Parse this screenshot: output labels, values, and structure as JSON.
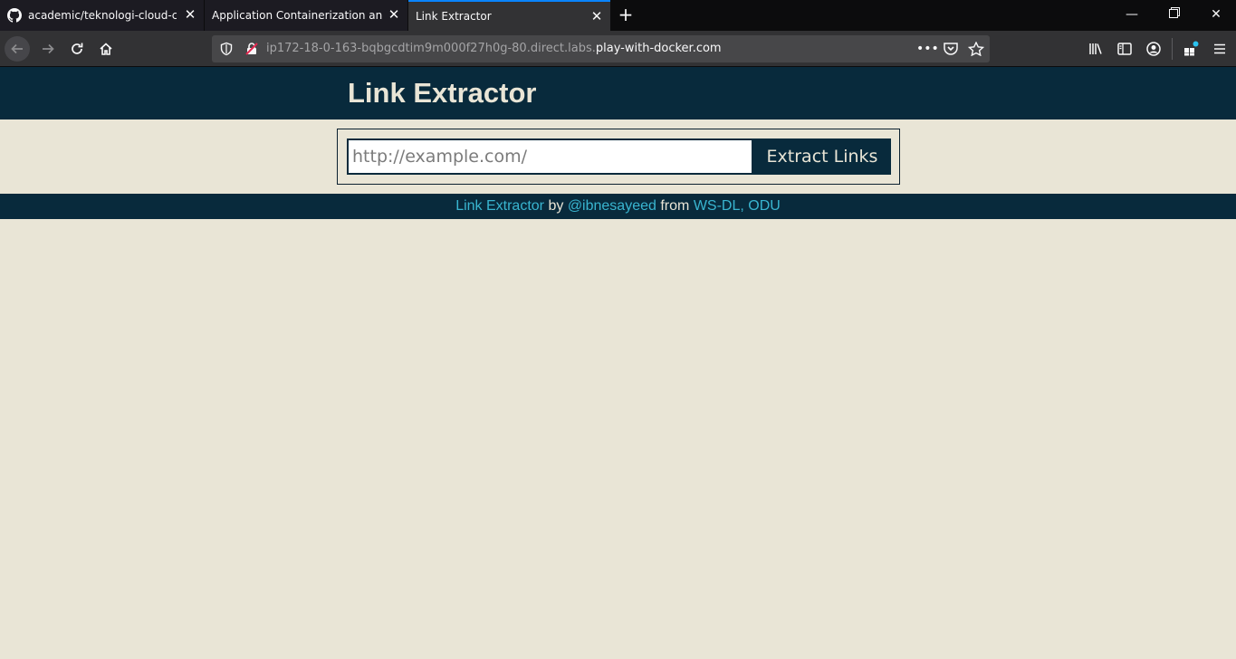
{
  "browser": {
    "tabs": [
      {
        "title": "academic/teknologi-cloud-com",
        "icon": "github-icon",
        "active": false
      },
      {
        "title": "Application Containerization and M",
        "active": false
      },
      {
        "title": "Link Extractor",
        "active": true
      }
    ],
    "url": {
      "prefix": "ip172-18-0-163-bqbgcdtim9m000f27h0g-80.direct.labs.",
      "domain": "play-with-docker.com"
    }
  },
  "page": {
    "title": "Link Extractor",
    "input_placeholder": "http://example.com/",
    "button_label": "Extract Links",
    "footer": {
      "app_link": "Link Extractor",
      "by": "by",
      "author_link": "@ibnesayeed",
      "from": "from",
      "org_link": "WS-DL, ODU"
    }
  },
  "colors": {
    "accent": "#082A3C",
    "background": "#E9E5D6",
    "link": "#39B5D0",
    "active_tab_indicator": "#0A84FF"
  }
}
